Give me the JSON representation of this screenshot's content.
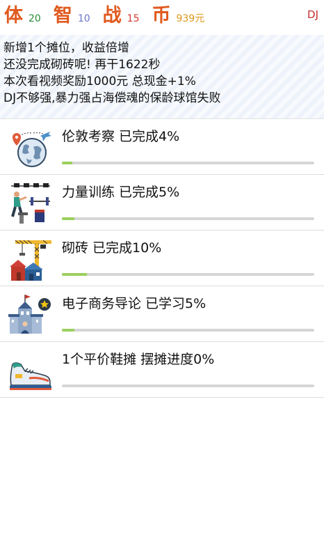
{
  "stats": {
    "body": {
      "label": "体",
      "value": "20"
    },
    "wisdom": {
      "label": "智",
      "value": "10"
    },
    "combat": {
      "label": "战",
      "value": "15"
    },
    "coin": {
      "label": "币",
      "value": "939元"
    }
  },
  "player": "DJ",
  "messages": [
    "新增1个摊位，收益倍增",
    "还没完成砌砖呢! 再干1622秒",
    "本次看视频奖励1000元 总现金+1%",
    "DJ不够强,暴力强占海偿魂的保龄球馆失败"
  ],
  "activities": [
    {
      "title": "伦敦考察 已完成4%",
      "progress": 0.04,
      "icon": "globe-travel-icon"
    },
    {
      "title": "力量训练 已完成5%",
      "progress": 0.05,
      "icon": "weightlifting-icon"
    },
    {
      "title": "砌砖 已完成10%",
      "progress": 0.1,
      "icon": "construction-crane-icon"
    },
    {
      "title": "电子商务导论 已学习5%",
      "progress": 0.05,
      "icon": "school-building-icon"
    },
    {
      "title": "1个平价鞋摊 摆摊进度0%",
      "progress": 0.0,
      "icon": "sneaker-icon"
    }
  ],
  "colors": {
    "stat_label": "#e05a1f",
    "progress_fill": "#9ccf5e",
    "progress_track": "#d6d6d6",
    "player": "#c62e2e"
  }
}
